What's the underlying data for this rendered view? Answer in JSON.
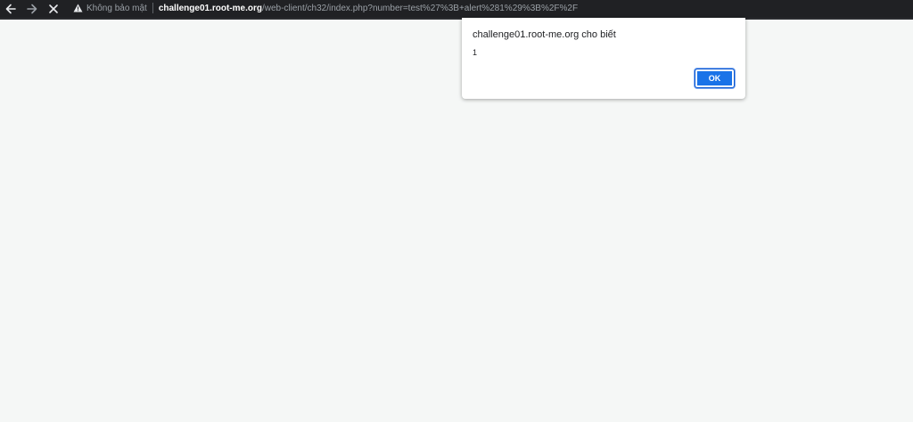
{
  "browser": {
    "security_label": "Không bảo mật",
    "url_host": "challenge01.root-me.org",
    "url_path": "/web-client/ch32/index.php?number=test%27%3B+alert%281%29%3B%2F%2F",
    "icons": {
      "back": "back-arrow-icon",
      "forward": "forward-arrow-icon",
      "stop": "close-icon",
      "security": "warning-triangle-icon"
    }
  },
  "dialog": {
    "title": "challenge01.root-me.org cho biết",
    "message": "1",
    "ok_label": "OK"
  },
  "colors": {
    "toolbar_bg": "#202124",
    "page_bg": "#f5f7f6",
    "button_blue": "#1a73e8"
  }
}
